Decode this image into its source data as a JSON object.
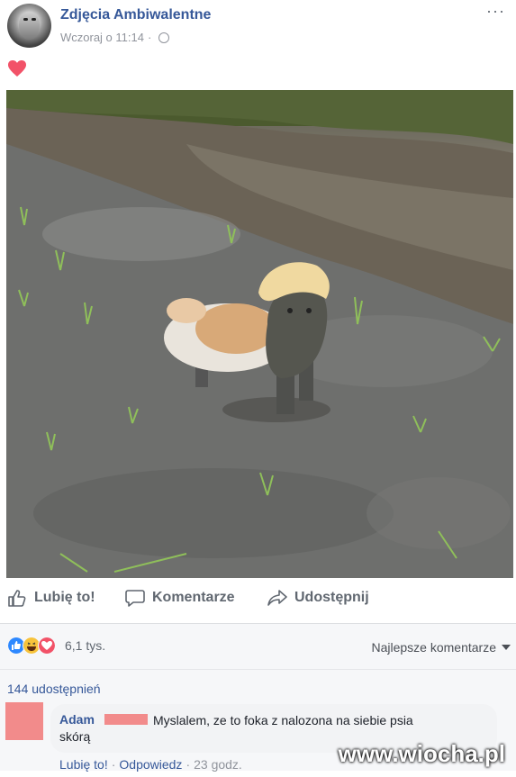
{
  "post": {
    "page_name": "Zdjęcia Ambiwalentne",
    "timestamp": "Wczoraj o 11:14",
    "separator": "·",
    "more_label": "···"
  },
  "actions": {
    "like": "Lubię to!",
    "comment": "Komentarze",
    "share": "Udostępnij"
  },
  "stats": {
    "reactions_count": "6,1 tys.",
    "sort_label": "Najlepsze komentarze",
    "shares": "144 udostępnień"
  },
  "comment": {
    "author": "Adam",
    "text_line1": "Myslalem, ze to foka z nalozona na siebie psia",
    "text_line2": "skórą",
    "like": "Lubię to!",
    "sep1": "·",
    "reply": "Odpowiedz",
    "sep2": "·",
    "time": "23 godz."
  },
  "watermark": "www.wiocha.pl",
  "colors": {
    "link": "#365899",
    "heart": "#f25268",
    "meta": "#90949c",
    "redact": "#f28b8b"
  }
}
